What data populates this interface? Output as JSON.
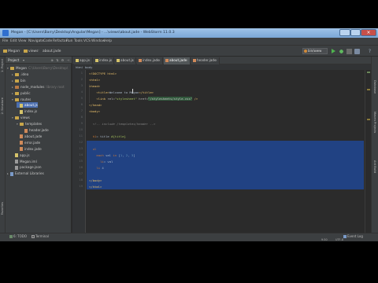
{
  "window": {
    "title": "Megan - [C:\\Users\\Barry\\Desktop\\Angular\\Megan] - ...\\views\\about.jade - WebStorm 11.0.3"
  },
  "menu": [
    "File",
    "Edit",
    "View",
    "Navigate",
    "Code",
    "Refactor",
    "Run",
    "Tools",
    "VCS",
    "Window",
    "Help"
  ],
  "navbar": {
    "crumbs": [
      "Megan",
      "views",
      "about.jade"
    ],
    "run_config": "bin/www"
  },
  "project_panel": {
    "title": "Project",
    "tree": [
      {
        "label": "Megan",
        "suffix": "C:\\Users\\Barry\\Desktop\\",
        "kind": "folder",
        "depth": 0,
        "arrow": "▾"
      },
      {
        "label": ".idea",
        "kind": "folder",
        "depth": 1,
        "arrow": "▸"
      },
      {
        "label": "bin",
        "kind": "folder",
        "depth": 1,
        "arrow": "▸"
      },
      {
        "label": "node_modules",
        "suffix": "library root",
        "kind": "folder-excluded",
        "depth": 1,
        "arrow": "▸"
      },
      {
        "label": "public",
        "kind": "folder",
        "depth": 1,
        "arrow": "▸"
      },
      {
        "label": "routes",
        "kind": "folder",
        "depth": 1,
        "arrow": "▾"
      },
      {
        "label": "about.js",
        "kind": "js",
        "depth": 2,
        "arrow": ""
      },
      {
        "label": "index.js",
        "kind": "js",
        "depth": 2,
        "arrow": ""
      },
      {
        "label": "views",
        "kind": "folder",
        "depth": 1,
        "arrow": "▾"
      },
      {
        "label": "templates",
        "kind": "folder",
        "depth": 2,
        "arrow": "▾"
      },
      {
        "label": "header.jade",
        "kind": "html",
        "depth": 3,
        "arrow": ""
      },
      {
        "label": "about.jade",
        "kind": "html",
        "depth": 2,
        "arrow": ""
      },
      {
        "label": "error.jade",
        "kind": "html",
        "depth": 2,
        "arrow": ""
      },
      {
        "label": "index.jade",
        "kind": "html",
        "depth": 2,
        "arrow": ""
      },
      {
        "label": "app.js",
        "kind": "js",
        "depth": 1,
        "arrow": ""
      },
      {
        "label": "Megan.iml",
        "kind": "json",
        "depth": 1,
        "arrow": ""
      },
      {
        "label": "package.json",
        "kind": "json",
        "depth": 1,
        "arrow": ""
      },
      {
        "label": "External Libraries",
        "kind": "lib",
        "depth": 0,
        "arrow": "▸"
      }
    ]
  },
  "tabs": [
    {
      "label": "app.js",
      "kind": "js"
    },
    {
      "label": "index.js",
      "kind": "js"
    },
    {
      "label": "about.js",
      "kind": "js"
    },
    {
      "label": "index.jade",
      "kind": "html"
    },
    {
      "label": "about.jade",
      "kind": "html",
      "active": true
    },
    {
      "label": "header.jade",
      "kind": "html"
    }
  ],
  "editor_breadcrumb": [
    "html",
    "body"
  ],
  "code": {
    "lines": [
      {
        "n": "1",
        "parts": [
          [
            "tag",
            "<!DOCTYPE html>"
          ]
        ]
      },
      {
        "n": "2",
        "parts": [
          [
            "tag",
            "<html>"
          ]
        ]
      },
      {
        "n": "3",
        "parts": [
          [
            "tag",
            "<head>"
          ]
        ]
      },
      {
        "n": "4",
        "parts": [
          [
            "plain",
            "    "
          ],
          [
            "tag",
            "<title>"
          ],
          [
            "plain",
            "Welcome to Megan"
          ],
          [
            "tag",
            "</title>"
          ]
        ]
      },
      {
        "n": "5",
        "parts": [
          [
            "plain",
            "    "
          ],
          [
            "tag",
            "<link "
          ],
          [
            "attr",
            "rel="
          ],
          [
            "str",
            "\"stylesheet\""
          ],
          [
            "attr",
            " href="
          ],
          [
            "hl",
            "\"/stylesheets/style.css\""
          ],
          [
            "tag",
            " />"
          ]
        ]
      },
      {
        "n": "6",
        "parts": [
          [
            "tag",
            "</head>"
          ]
        ]
      },
      {
        "n": "7",
        "parts": [
          [
            "tag",
            "<body>"
          ]
        ]
      },
      {
        "n": "8",
        "parts": [
          [
            "plain",
            ""
          ]
        ]
      },
      {
        "n": "9",
        "parts": [
          [
            "plain",
            "  "
          ],
          [
            "cmt",
            "<!-- include /templates/header -->"
          ]
        ]
      },
      {
        "n": "10",
        "parts": [
          [
            "plain",
            ""
          ]
        ]
      },
      {
        "n": "11",
        "parts": [
          [
            "plain",
            "  "
          ],
          [
            "kw",
            "h1"
          ],
          [
            "plain",
            "= title "
          ],
          [
            "str",
            "#{title}"
          ]
        ]
      },
      {
        "n": "12",
        "parts": [
          [
            "plain",
            ""
          ]
        ]
      },
      {
        "n": "13",
        "parts": [
          [
            "plain",
            "  "
          ],
          [
            "kw",
            "ul"
          ]
        ]
      },
      {
        "n": "14",
        "parts": [
          [
            "plain",
            "    "
          ],
          [
            "kw",
            "each"
          ],
          [
            "plain",
            " val "
          ],
          [
            "kw",
            "in"
          ],
          [
            "plain",
            " ["
          ],
          [
            "num",
            "1"
          ],
          [
            "plain",
            ", "
          ],
          [
            "num",
            "2"
          ],
          [
            "plain",
            ", "
          ],
          [
            "num",
            "3"
          ],
          [
            "plain",
            "]"
          ]
        ]
      },
      {
        "n": "15",
        "parts": [
          [
            "plain",
            "      "
          ],
          [
            "kw",
            "li"
          ],
          [
            "plain",
            "= val"
          ]
        ]
      },
      {
        "n": "16",
        "parts": [
          [
            "plain",
            "    "
          ],
          [
            "kw",
            "li"
          ],
          [
            "plain",
            " 4"
          ]
        ]
      },
      {
        "n": "17",
        "parts": [
          [
            "plain",
            ""
          ]
        ]
      },
      {
        "n": "18",
        "parts": [
          [
            "tag",
            "</body>"
          ]
        ]
      },
      {
        "n": "19",
        "parts": [
          [
            "tag",
            "</html>"
          ]
        ]
      }
    ]
  },
  "left_strip": [
    "1: Project",
    "2: Structure",
    "Favorites"
  ],
  "right_strip": [
    "Database",
    "Maven Projects",
    "Ant Build"
  ],
  "bottom_tools": [
    {
      "label": "6: TODO",
      "icon": "todo-icon"
    },
    {
      "label": "Terminal",
      "icon": "terminal-icon"
    },
    {
      "label": "Event Log",
      "icon": "event-log-icon"
    }
  ],
  "status": {
    "position": "9:30",
    "encoding": "UTF-8"
  }
}
